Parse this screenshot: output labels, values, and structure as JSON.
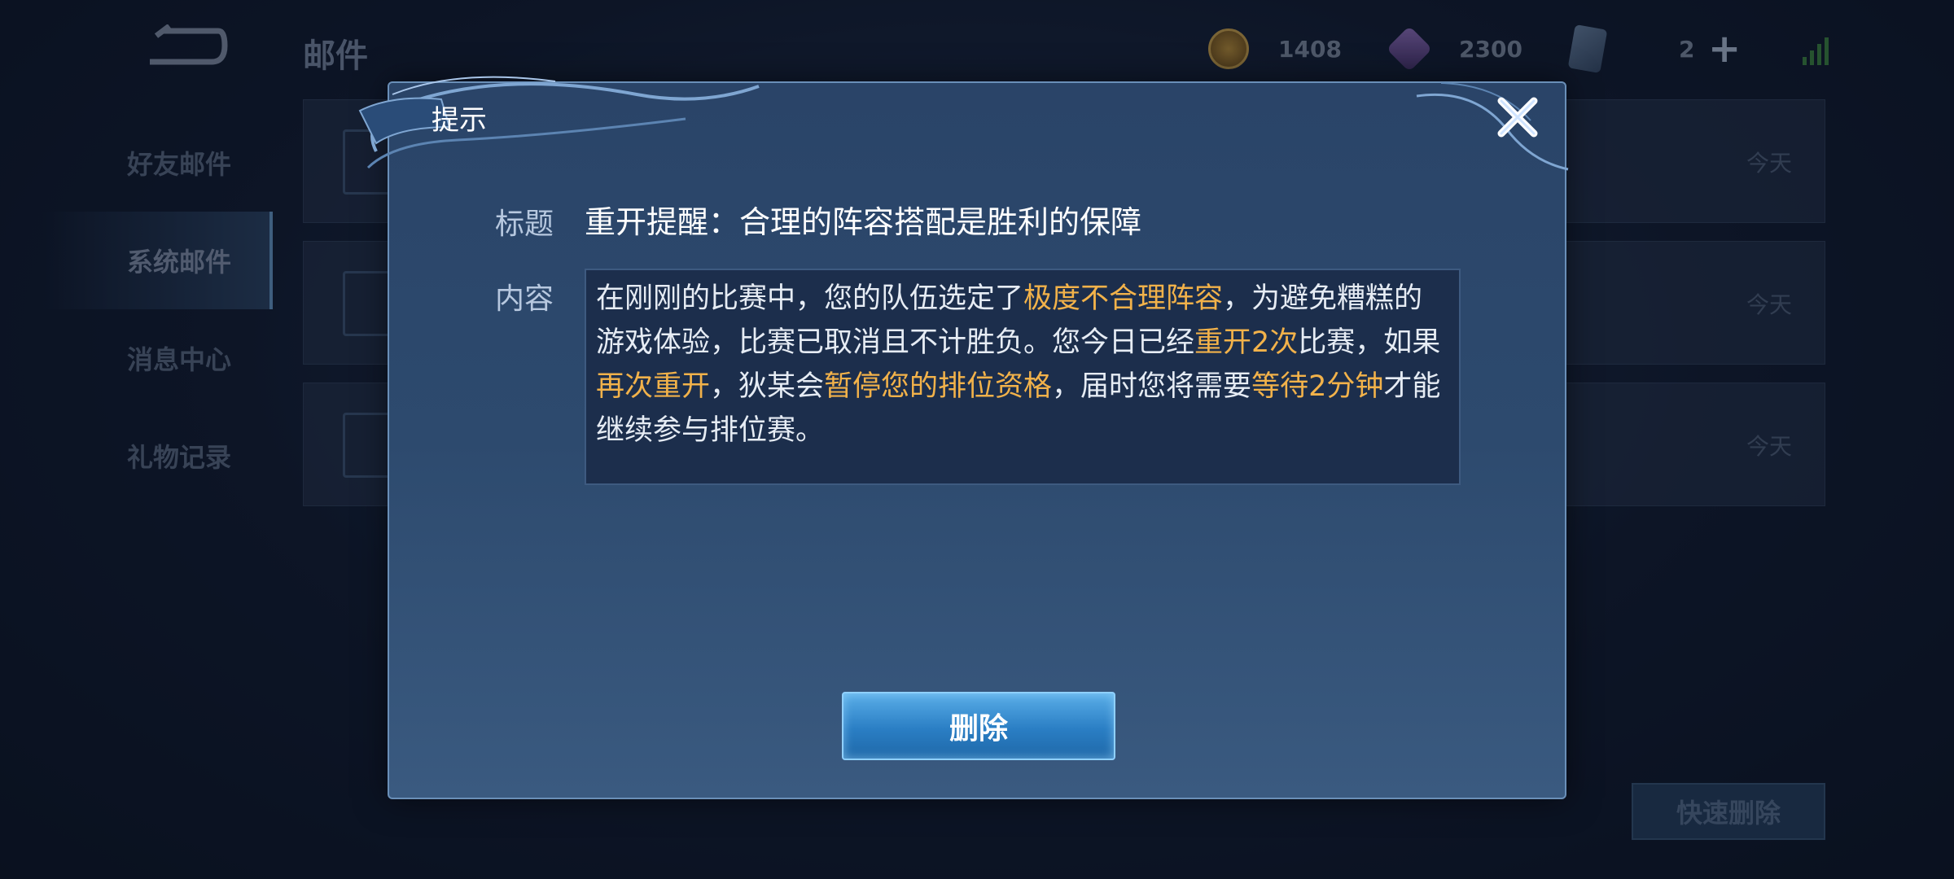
{
  "header": {
    "title": "邮件",
    "gold": "1408",
    "gems": "2300",
    "cards": "2"
  },
  "sidebar": {
    "items": [
      {
        "label": "好友邮件"
      },
      {
        "label": "系统邮件"
      },
      {
        "label": "消息中心"
      },
      {
        "label": "礼物记录"
      }
    ]
  },
  "mail_list": {
    "dates": [
      "今天",
      "今天",
      "今天"
    ]
  },
  "quick_delete_label": "快速删除",
  "dialog": {
    "title": "提示",
    "subject_label": "标题",
    "subject": "重开提醒：合理的阵容搭配是胜利的保障",
    "content_label": "内容",
    "content_parts": [
      "在刚刚的比赛中，您的队伍选定了",
      "极度不合理阵容",
      "，为避免糟糕的游戏体验，比赛已取消且不计胜负。您今日已经",
      "重开2次",
      "比赛，如果",
      "再次重开",
      "，狄某会",
      "暂停您的排位资格",
      "，届时您将需要",
      "等待2分钟",
      "才能继续参与排位赛。"
    ],
    "delete_label": "删除"
  },
  "colors": {
    "highlight": "#f2b24a",
    "button": "#2a7ec4"
  }
}
